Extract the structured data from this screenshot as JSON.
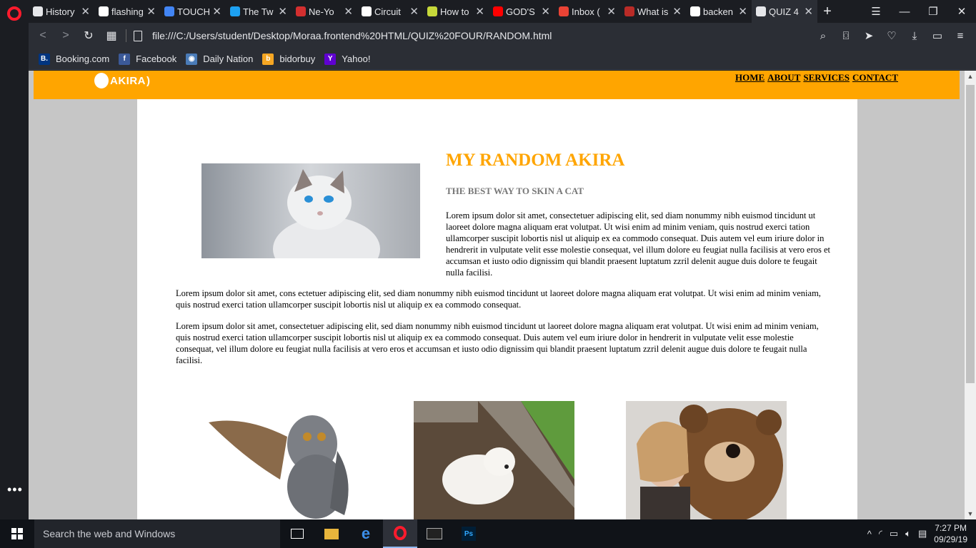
{
  "browser": {
    "tabs": [
      {
        "label": "History",
        "icon": "clock-icon",
        "color": "#e6e7ea"
      },
      {
        "label": "flashing",
        "icon": "google-icon",
        "color": "#ffffff"
      },
      {
        "label": "TOUCH",
        "icon": "docs-icon",
        "color": "#4285f4"
      },
      {
        "label": "The Tw",
        "icon": "play-icon",
        "color": "#1da1f2"
      },
      {
        "label": "Ne-Yo",
        "icon": "music-icon",
        "color": "#d32f2f"
      },
      {
        "label": "Circuit",
        "icon": "circuit-icon",
        "color": "#ffffff"
      },
      {
        "label": "How to",
        "icon": "l-icon",
        "color": "#c6d83a"
      },
      {
        "label": "GOD'S",
        "icon": "youtube-icon",
        "color": "#ff0000"
      },
      {
        "label": "Inbox (",
        "icon": "gmail-icon",
        "color": "#ea4335"
      },
      {
        "label": "What is",
        "icon": "quora-icon",
        "color": "#b92b27"
      },
      {
        "label": "backen",
        "icon": "google-icon",
        "color": "#ffffff"
      },
      {
        "label": "QUIZ 4",
        "icon": "file-icon",
        "color": "#e6e7ea",
        "active": true
      }
    ],
    "url": "file:///C:/Users/student/Desktop/Moraa.frontend%20HTML/QUIZ%20FOUR/RANDOM.html",
    "bookmarks": [
      {
        "label": "Booking.com",
        "badge": "B.",
        "color": "#003580"
      },
      {
        "label": "Facebook",
        "badge": "f",
        "color": "#3b5998"
      },
      {
        "label": "Daily Nation",
        "badge": "◉",
        "color": "#4a7bb7"
      },
      {
        "label": "bidorbuy",
        "badge": "b",
        "color": "#f5a623"
      },
      {
        "label": "Yahoo!",
        "badge": "Y",
        "color": "#5f01d1"
      }
    ]
  },
  "site": {
    "logo_text": "AKIRA",
    "nav": [
      "HOME",
      "ABOUT",
      "SERVICES",
      "CONTACT"
    ],
    "title": "MY RANDOM AKIRA",
    "subtitle": "THE BEST WAY TO SKIN A CAT",
    "p1": "Lorem ipsum dolor sit amet, consectetuer adipiscing elit, sed diam nonummy nibh euismod tincidunt ut laoreet dolore magna aliquam erat volutpat. Ut wisi enim ad minim veniam, quis nostrud exerci tation ullamcorper suscipit lobortis nisl ut aliquip ex ea commodo consequat. Duis autem vel eum iriure dolor in hendrerit in vulputate velit esse molestie consequat, vel illum dolore eu feugiat nulla facilisis at vero eros et accumsan et iusto odio dignissim qui blandit praesent luptatum zzril delenit augue duis dolore te feugait nulla facilisi.",
    "p2": "Lorem ipsum dolor sit amet, cons ectetuer adipiscing elit, sed diam nonummy nibh euismod tincidunt ut laoreet dolore magna aliquam erat volutpat. Ut wisi enim ad minim veniam, quis nostrud exerci tation ullamcorper suscipit lobortis nisl ut aliquip ex ea commodo consequat.",
    "p3": "Lorem ipsum dolor sit amet, consectetuer adipiscing elit, sed diam nonummy nibh euismod tincidunt ut laoreet dolore magna aliquam erat volutpat. Ut wisi enim ad minim veniam, quis nostrud exerci tation ullamcorper suscipit lobortis nisl ut aliquip ex ea commodo consequat. Duis autem vel eum iriure dolor in hendrerit in vulputate velit esse molestie consequat, vel illum dolore eu feugiat nulla facilisis at vero eros et accumsan et iusto odio dignissim qui blandit praesent luptatum zzril delenit augue duis dolore te feugait nulla facilisi.",
    "accent": "#ffa500"
  },
  "taskbar": {
    "search_placeholder": "Search the web and Windows",
    "time": "7:27 PM",
    "date": "09/29/19"
  }
}
